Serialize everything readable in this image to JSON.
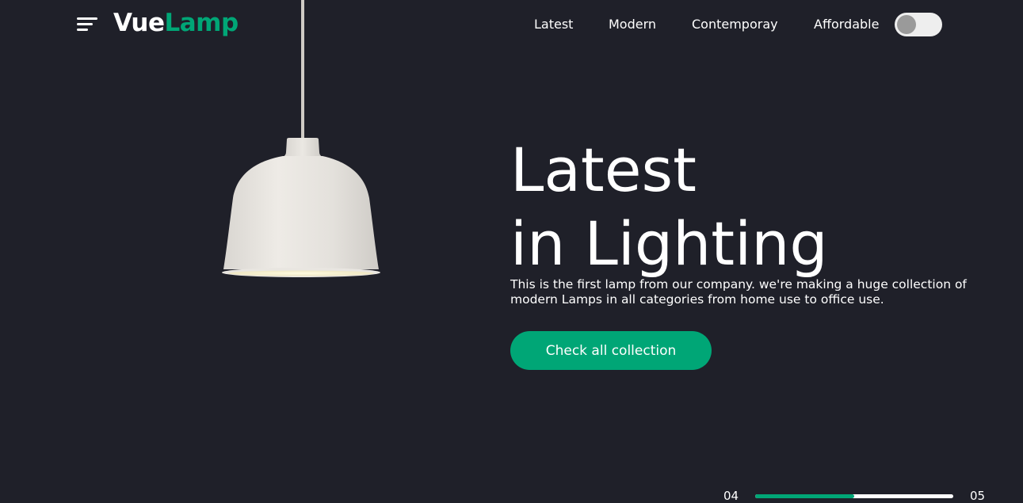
{
  "header": {
    "logo": {
      "part1": "Vue",
      "part2": "Lamp"
    },
    "nav": [
      {
        "label": "Latest"
      },
      {
        "label": "Modern"
      },
      {
        "label": "Contemporay"
      },
      {
        "label": "Affordable"
      }
    ],
    "theme_toggle": {
      "on": false
    }
  },
  "hero": {
    "title_line1": "Latest",
    "title_line2": "in Lighting",
    "description": "This is the first lamp from our company. we're making a huge collection of modern Lamps in all categories from home use to office use.",
    "cta_label": "Check all collection"
  },
  "pager": {
    "current": "04",
    "total": "05",
    "progress": 0.5
  },
  "colors": {
    "background": "#1f2029",
    "accent": "#00a676",
    "text": "#ffffff"
  },
  "icons": {
    "menu": "hamburger-menu-icon",
    "lamp": "pendant-lamp-image"
  }
}
